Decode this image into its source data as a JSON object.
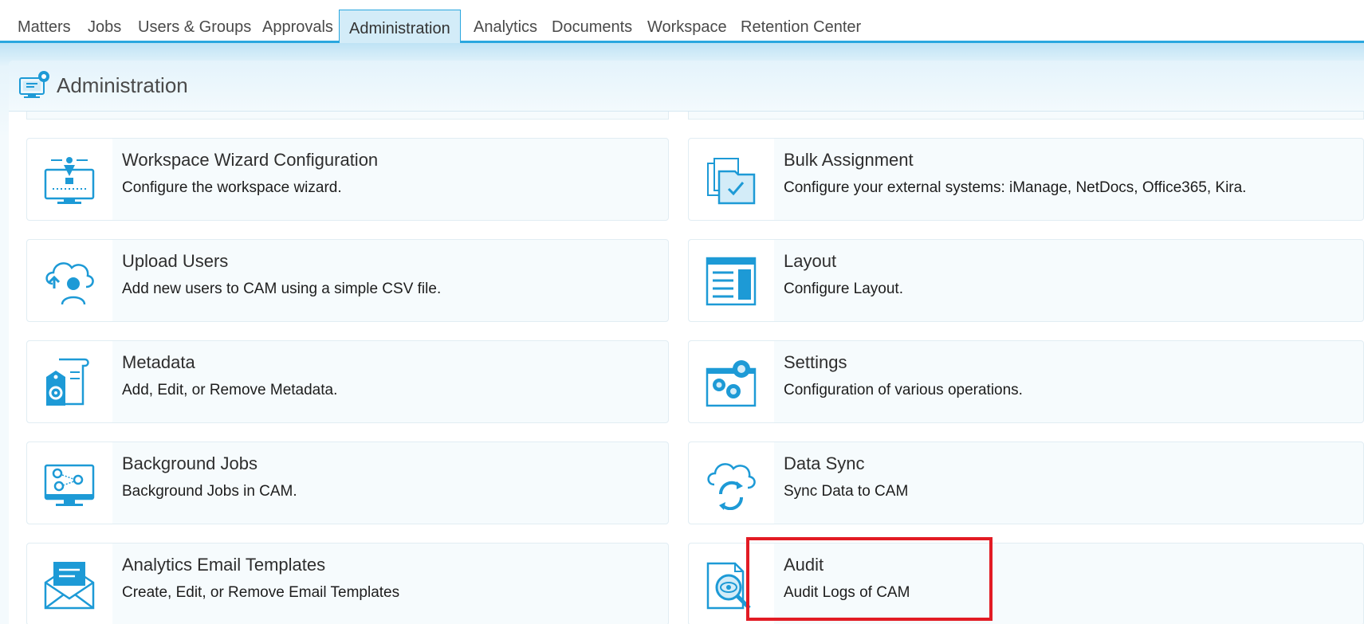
{
  "nav": {
    "tabs": [
      {
        "label": "Matters"
      },
      {
        "label": "Jobs"
      },
      {
        "label": "Users & Groups"
      },
      {
        "label": "Approvals"
      },
      {
        "label": "Administration",
        "active": true
      },
      {
        "label": "Analytics"
      },
      {
        "label": "Documents"
      },
      {
        "label": "Workspace"
      },
      {
        "label": "Retention Center"
      }
    ]
  },
  "header": {
    "title": "Administration",
    "icon": "admin-monitor-gear-icon"
  },
  "cards": [
    {
      "title": "Workspace Wizard Configuration",
      "description": "Configure the workspace wizard.",
      "icon": "workspace-wizard-icon"
    },
    {
      "title": "Bulk Assignment",
      "description": "Configure your external systems: iManage, NetDocs, Office365, Kira.",
      "icon": "bulk-assignment-icon"
    },
    {
      "title": "Upload Users",
      "description": "Add new users to CAM using a simple CSV file.",
      "icon": "upload-users-icon"
    },
    {
      "title": "Layout",
      "description": "Configure Layout.",
      "icon": "layout-icon"
    },
    {
      "title": "Metadata",
      "description": "Add, Edit, or Remove Metadata.",
      "icon": "metadata-icon"
    },
    {
      "title": "Settings",
      "description": "Configuration of various operations.",
      "icon": "settings-gears-icon"
    },
    {
      "title": "Background Jobs",
      "description": "Background Jobs in CAM.",
      "icon": "background-jobs-icon"
    },
    {
      "title": "Data Sync",
      "description": "Sync Data to CAM",
      "icon": "data-sync-icon"
    },
    {
      "title": "Analytics Email Templates",
      "description": "Create, Edit, or Remove Email Templates",
      "icon": "email-templates-icon"
    },
    {
      "title": "Audit",
      "description": "Audit Logs of CAM",
      "icon": "audit-icon",
      "highlighted": true
    }
  ],
  "colors": {
    "accent": "#2aa7df",
    "icon": "#1d9ad6",
    "highlight": "#e21b24"
  }
}
